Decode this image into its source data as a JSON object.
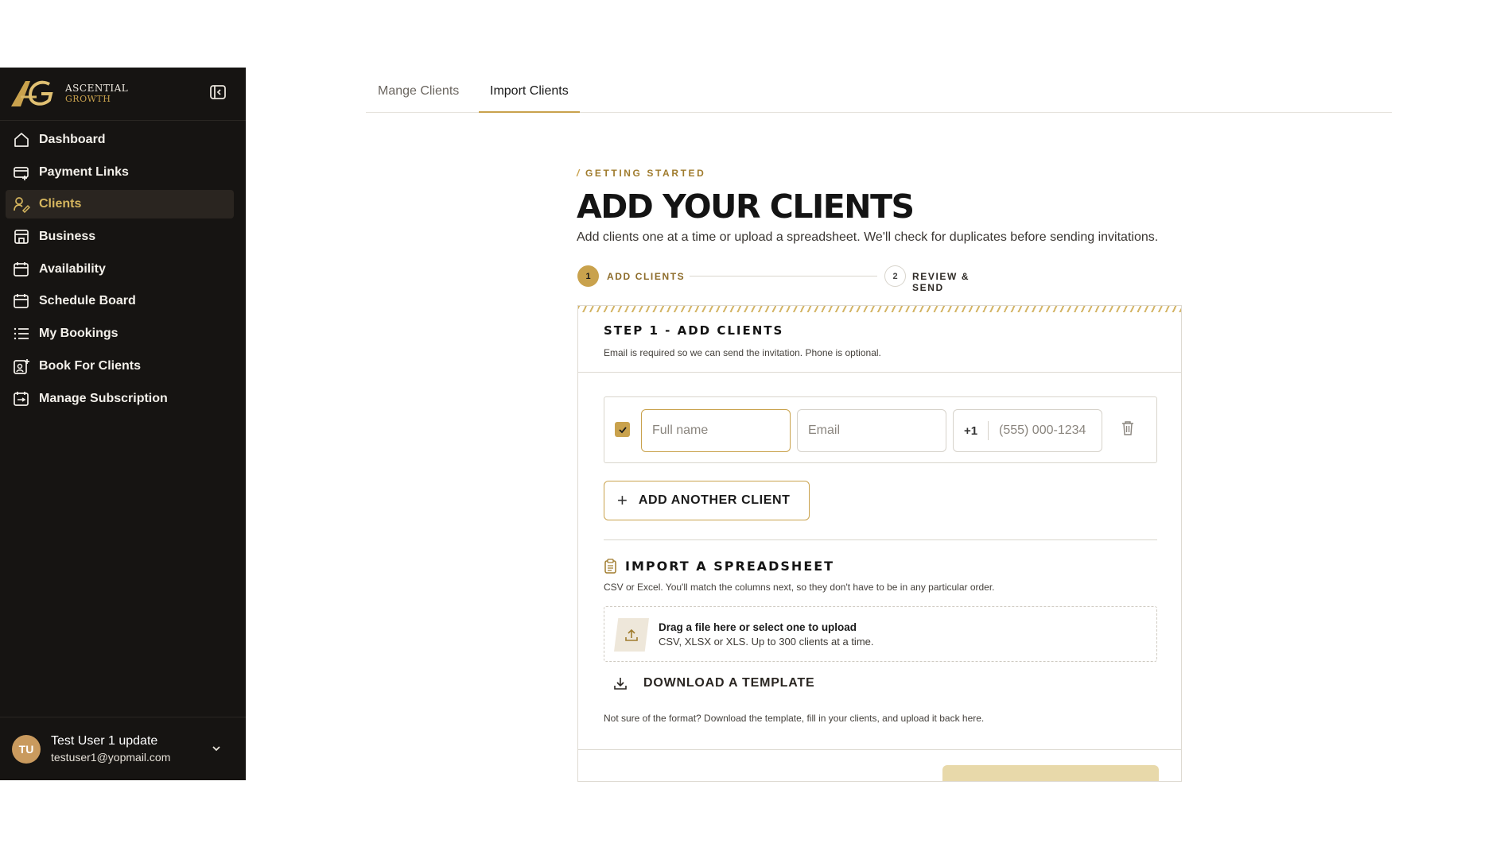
{
  "brand": {
    "line1": "ASCENTIAL",
    "line2": "GROWTH"
  },
  "sidebar": {
    "items": [
      {
        "label": "Dashboard",
        "icon": "home-icon"
      },
      {
        "label": "Payment Links",
        "icon": "payment-link-icon"
      },
      {
        "label": "Clients",
        "icon": "clients-icon",
        "active": true
      },
      {
        "label": "Business",
        "icon": "business-icon"
      },
      {
        "label": "Availability",
        "icon": "calendar-icon"
      },
      {
        "label": "Schedule Board",
        "icon": "schedule-icon"
      },
      {
        "label": "My Bookings",
        "icon": "list-icon"
      },
      {
        "label": "Book For Clients",
        "icon": "book-clients-icon"
      },
      {
        "label": "Manage Subscription",
        "icon": "subscription-icon"
      }
    ]
  },
  "user": {
    "initials": "TU",
    "name": "Test User 1 update",
    "email": "testuser1@yopmail.com"
  },
  "tabs": [
    {
      "label": "Mange Clients"
    },
    {
      "label": "Import Clients",
      "active": true
    }
  ],
  "page": {
    "eyebrow": "GETTING STARTED",
    "title": "ADD YOUR CLIENTS",
    "subtitle": "Add clients one at a time or upload a spreadsheet. We'll check for duplicates before sending invitations."
  },
  "stepper": [
    {
      "num": "1",
      "label": "ADD CLIENTS"
    },
    {
      "num": "2",
      "label": "REVIEW & SEND"
    }
  ],
  "card": {
    "title": "STEP 1 - ADD CLIENTS",
    "desc": "Email is required so we can send the invitation. Phone is optional.",
    "row": {
      "name_placeholder": "Full name",
      "email_placeholder": "Email",
      "phone_code": "+1",
      "phone_placeholder": "(555) 000-1234"
    },
    "add_button": "ADD ANOTHER CLIENT",
    "import": {
      "title": "IMPORT A SPREADSHEET",
      "desc": "CSV or Excel. You'll match the columns next, so they don't have to be in any particular order.",
      "drop_title": "Drag a file here or select one to upload",
      "drop_sub": "CSV, XLSX or XLS. Up to 300 clients at a time."
    },
    "download": {
      "label": "DOWNLOAD A TEMPLATE",
      "desc": "Not sure of the format? Download the template, fill in your clients, and upload it back here."
    }
  },
  "colors": {
    "accent": "#c9a24d",
    "sidebar_bg": "#161412",
    "active_text": "#d6b65e"
  }
}
